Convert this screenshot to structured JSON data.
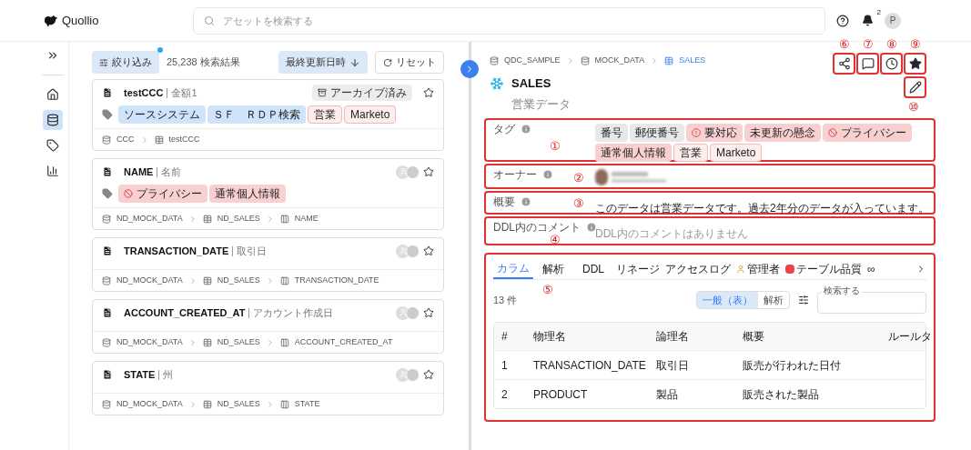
{
  "header": {
    "logo": "Quollio",
    "search": {
      "placeholder": "アセットを検索する"
    },
    "notification_count": "2",
    "avatar": "P"
  },
  "sidebar": {
    "items": [
      {
        "kind": "home",
        "selected": false
      },
      {
        "kind": "database",
        "selected": true
      },
      {
        "kind": "tag",
        "selected": false
      },
      {
        "kind": "chart",
        "selected": false
      }
    ]
  },
  "results": {
    "filter_button": "絞り込み",
    "filter_active": true,
    "count": "25,238 検索結果",
    "sort_button": "最終更新日時",
    "reset_button": "リセット",
    "cards": [
      {
        "title": "testCCC",
        "subtitle": "金額1",
        "badge": "アーカイブ済み",
        "owners": false,
        "starred": false,
        "tags": [
          {
            "label": "ソースシステム",
            "kind": "plain",
            "color": "#cfe3fb"
          },
          {
            "label": "ＳＦ　ＲＤＰ検索",
            "kind": "plain",
            "color": "#cfe3fb"
          },
          {
            "label": "営業",
            "kind": "outline",
            "color": "#fdeeee"
          },
          {
            "label": "Marketo",
            "kind": "outline",
            "color": "#fdeeee"
          }
        ],
        "path": [
          {
            "kind": "database",
            "label": "CCC"
          },
          {
            "kind": "table",
            "label": "testCCC"
          }
        ]
      },
      {
        "title": "NAME",
        "subtitle": "名前",
        "owners": true,
        "starred": false,
        "tags": [
          {
            "label": "プライバシー",
            "kind": "privacy",
            "color": "#f9d0d0"
          },
          {
            "label": "通常個人情報",
            "kind": "plain",
            "color": "#f9d0d0"
          }
        ],
        "path": [
          {
            "kind": "database",
            "label": "ND_MOCK_DATA"
          },
          {
            "kind": "table",
            "label": "ND_SALES"
          },
          {
            "kind": "column",
            "label": "NAME"
          }
        ]
      },
      {
        "title": "TRANSACTION_DATE",
        "subtitle": "取引日",
        "owners": true,
        "starred": false,
        "path": [
          {
            "kind": "database",
            "label": "ND_MOCK_DATA"
          },
          {
            "kind": "table",
            "label": "ND_SALES"
          },
          {
            "kind": "column",
            "label": "TRANSACTION_DATE"
          }
        ]
      },
      {
        "title": "ACCOUNT_CREATED_AT",
        "subtitle": "アカウント作成日",
        "owners": true,
        "starred": false,
        "path": [
          {
            "kind": "database",
            "label": "ND_MOCK_DATA"
          },
          {
            "kind": "table",
            "label": "ND_SALES"
          },
          {
            "kind": "column",
            "label": "ACCOUNT_CREATED_AT"
          }
        ]
      },
      {
        "title": "STATE",
        "subtitle": "州",
        "owners": true,
        "starred": false,
        "path": [
          {
            "kind": "database",
            "label": "ND_MOCK_DATA"
          },
          {
            "kind": "table",
            "label": "ND_SALES"
          },
          {
            "kind": "column",
            "label": "STATE"
          }
        ]
      }
    ]
  },
  "detail": {
    "breadcrumb": [
      {
        "kind": "database",
        "label": "QDC_SAMPLE",
        "selected": false
      },
      {
        "kind": "database",
        "label": "MOCK_DATA",
        "selected": false
      },
      {
        "kind": "table",
        "label": "SALES",
        "selected": true
      }
    ],
    "actions": [
      {
        "kind": "share",
        "annotation": "⑥"
      },
      {
        "kind": "comment",
        "annotation": "⑦"
      },
      {
        "kind": "history",
        "annotation": "⑧"
      },
      {
        "kind": "star",
        "annotation": "⑨",
        "on": true
      }
    ],
    "edit_annotation": "⑩",
    "title": "SALES",
    "subtitle": "営業データ",
    "tags_section": {
      "label": "タグ",
      "annotation": "①",
      "tags": [
        {
          "label": "番号",
          "kind": "plain",
          "color": "#e8e8ea"
        },
        {
          "label": "郵便番号",
          "kind": "plain",
          "color": "#e8e8ea"
        },
        {
          "label": "要対応",
          "kind": "alert",
          "color": "#f9d0d0"
        },
        {
          "label": "未更新の懸念",
          "kind": "plain",
          "color": "#f9d0d0"
        },
        {
          "label": "プライバシー",
          "kind": "privacy",
          "color": "#f9d0d0"
        },
        {
          "label": "通常個人情報",
          "kind": "plain",
          "color": "#f9d0d0"
        },
        {
          "label": "営業",
          "kind": "outline",
          "color": "#fdeeee"
        },
        {
          "label": "Marketo",
          "kind": "outline",
          "color": "#fdeeee"
        }
      ]
    },
    "owner_section": {
      "label": "オーナー",
      "annotation": "②"
    },
    "summary_section": {
      "label": "概要",
      "annotation": "③",
      "text": "このデータは営業データです。過去2年分のデータが入っています。"
    },
    "ddl_section": {
      "label": "DDL内のコメント",
      "annotation": "④",
      "placeholder": "DDL内のコメントはありません"
    },
    "tabs_section": {
      "annotation": "⑤",
      "tabs": [
        {
          "label": "カラム",
          "kind": "plain",
          "selected": true
        },
        {
          "label": "解析",
          "kind": "plain",
          "selected": false
        },
        {
          "label": "DDL",
          "kind": "plain",
          "selected": false
        },
        {
          "label": "リネージ",
          "kind": "plain",
          "selected": false
        },
        {
          "label": "アクセスログ",
          "kind": "plain",
          "selected": false
        },
        {
          "label": "管理者",
          "kind": "admin",
          "selected": false
        },
        {
          "label": "テーブル品質",
          "kind": "quality",
          "selected": false
        },
        {
          "label": "∞",
          "kind": "plain",
          "selected": false
        }
      ],
      "count": "13 件",
      "views": [
        {
          "label": "一般（表）",
          "selected": true
        },
        {
          "label": "解析",
          "selected": false
        }
      ],
      "search_label": "検索する",
      "table": {
        "columns": [
          "#",
          "物理名",
          "論理名",
          "概要",
          "ルールタ"
        ],
        "rows": [
          [
            "1",
            "TRANSACTION_DATE",
            "取引日",
            "販売が行われた日付",
            ""
          ],
          [
            "2",
            "PRODUCT",
            "製品",
            "販売された製品",
            ""
          ]
        ]
      }
    }
  }
}
